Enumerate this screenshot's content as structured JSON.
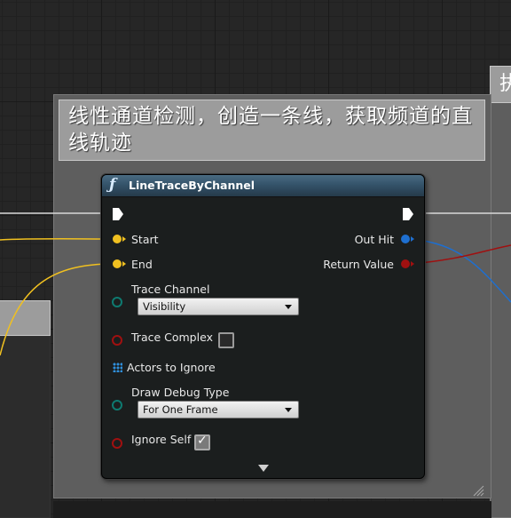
{
  "comment_main": {
    "title": "线性通道检测，创造一条线，获取频道的直线轨迹"
  },
  "comment_right": {
    "title": "执"
  },
  "node": {
    "title": "LineTraceByChannel",
    "icon": "function-icon",
    "inputs": {
      "start": "Start",
      "end": "End",
      "trace_channel": "Trace Channel",
      "trace_channel_value": "Visibility",
      "trace_complex": "Trace Complex",
      "trace_complex_checked": false,
      "actors_to_ignore": "Actors to Ignore",
      "draw_debug_type": "Draw Debug Type",
      "draw_debug_type_value": "For One Frame",
      "ignore_self": "Ignore Self",
      "ignore_self_checked": true
    },
    "outputs": {
      "out_hit": "Out Hit",
      "return_value": "Return Value"
    }
  },
  "colors": {
    "vector_pin": "#f0c020",
    "struct_pin": "#1e6fd0",
    "bool_pin": "#a01010",
    "enum_pin": "#0e7a70",
    "array_pin": "#2f8fdb",
    "exec_wire": "#e0e0e0",
    "node_header": "#34536a"
  }
}
